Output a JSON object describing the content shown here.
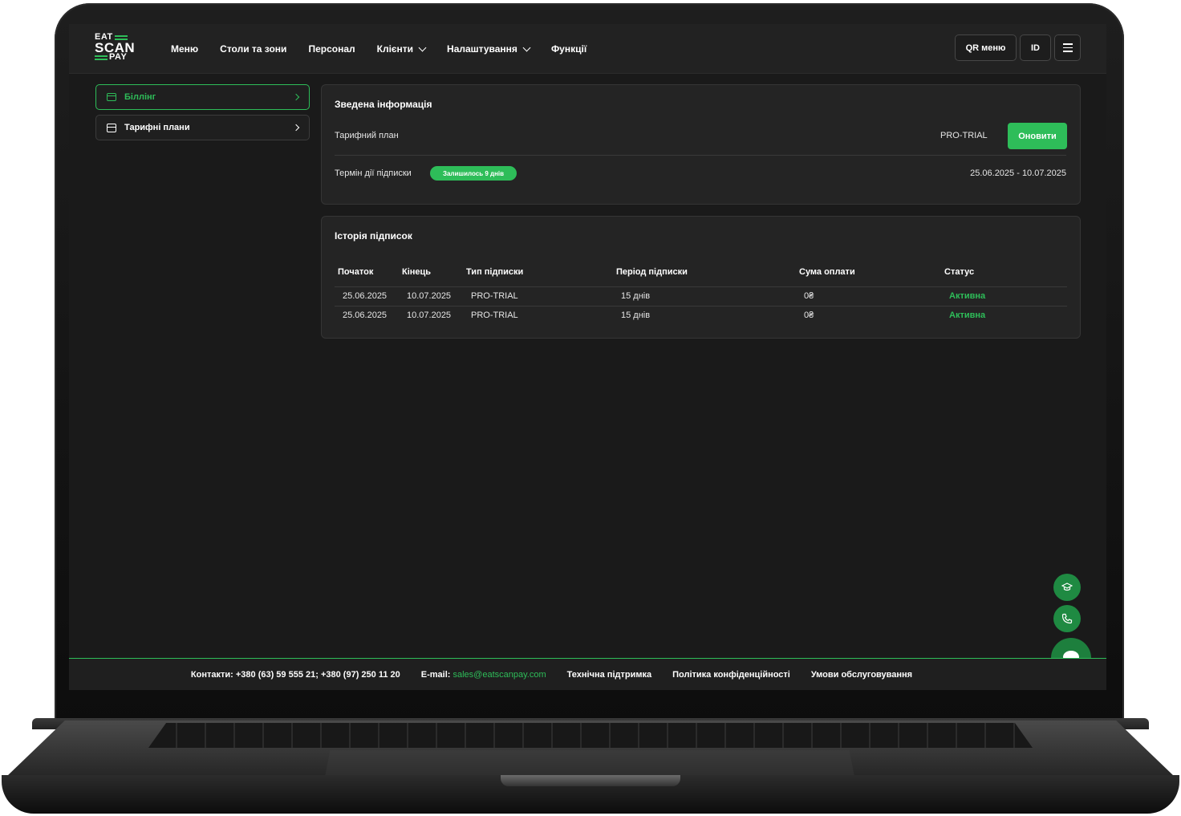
{
  "logo": {
    "line1": "EAT",
    "line2": "SCAN",
    "line3": "PAY"
  },
  "nav": [
    {
      "label": "Меню",
      "dropdown": false
    },
    {
      "label": "Столи та зони",
      "dropdown": false
    },
    {
      "label": "Персонал",
      "dropdown": false
    },
    {
      "label": "Клієнти",
      "dropdown": true
    },
    {
      "label": "Налаштування",
      "dropdown": true
    },
    {
      "label": "Функції",
      "dropdown": false
    }
  ],
  "header_buttons": {
    "qr": "QR меню",
    "id": "ID",
    "menu_icon": "hamburger-icon"
  },
  "sidebar": [
    {
      "label": "Біллінг",
      "icon": "card-icon",
      "active": true
    },
    {
      "label": "Тарифні плани",
      "icon": "box-icon",
      "active": false
    }
  ],
  "summary": {
    "title": "Зведена інформація",
    "plan_label": "Тарифний план",
    "plan_value": "PRO-TRIAL",
    "update_button": "Оновити",
    "term_label": "Термін дії підписки",
    "remaining_badge": "Залишилось 9 днів",
    "term_value": "25.06.2025 - 10.07.2025"
  },
  "history": {
    "title": "Історія підписок",
    "columns": [
      "Початок",
      "Кінець",
      "Тип підписки",
      "Період підписки",
      "Сума оплати",
      "Статус"
    ],
    "rows": [
      [
        "25.06.2025",
        "10.07.2025",
        "PRO-TRIAL",
        "15 днів",
        "0₴",
        "Активна"
      ],
      [
        "25.06.2025",
        "10.07.2025",
        "PRO-TRIAL",
        "15 днів",
        "0₴",
        "Активна"
      ]
    ]
  },
  "footer": {
    "contacts_label": "Контакти:",
    "contacts_value": "+380 (63) 59 555 21; +380 (97) 250 11 20",
    "email_label": "E-mail:",
    "email_value": "sales@eatscanpay.com",
    "support": "Технічна підтримка",
    "privacy": "Політика конфіденційності",
    "terms": "Умови обслуговування"
  },
  "colors": {
    "accent": "#2ebd59",
    "background": "#1a1a1a",
    "card": "#242424"
  },
  "fabs": [
    "graduation-cap-icon",
    "phone-icon",
    "chat-icon"
  ]
}
